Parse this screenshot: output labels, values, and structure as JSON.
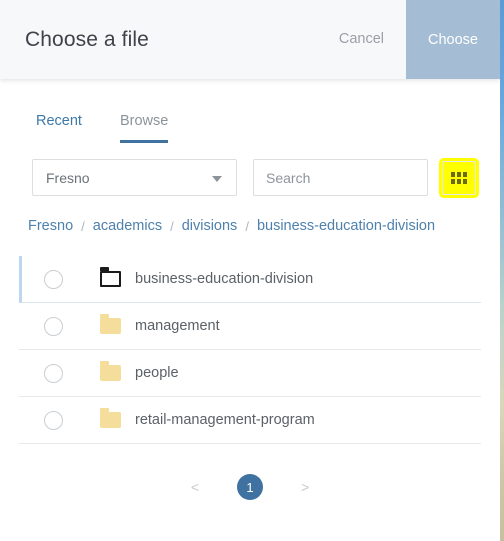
{
  "dialog": {
    "title": "Choose a file",
    "cancel_label": "Cancel",
    "choose_label": "Choose",
    "choose_button_color": "#a4bcd4",
    "header_background": "#f7f8f9"
  },
  "tabs": [
    {
      "label": "Recent",
      "active": false
    },
    {
      "label": "Browse",
      "active": true
    }
  ],
  "filters": {
    "site_select": {
      "value": "Fresno",
      "icon": "chevron-down-icon"
    },
    "search": {
      "value": "",
      "placeholder": "Search"
    },
    "view_toggle": {
      "icon": "grid-view-icon",
      "highlight_color": "#ffff00"
    }
  },
  "breadcrumb": {
    "separator": "/",
    "items": [
      "Fresno",
      "academics",
      "divisions",
      "business-education-division"
    ]
  },
  "files": [
    {
      "name": "business-education-division",
      "icon": "folder-open-outline-icon",
      "selected": true
    },
    {
      "name": "management",
      "icon": "folder-icon",
      "selected": false
    },
    {
      "name": "people",
      "icon": "folder-icon",
      "selected": false
    },
    {
      "name": "retail-management-program",
      "icon": "folder-icon",
      "selected": false
    }
  ],
  "pagination": {
    "prev_label": "<",
    "next_label": ">",
    "current_page": "1"
  }
}
